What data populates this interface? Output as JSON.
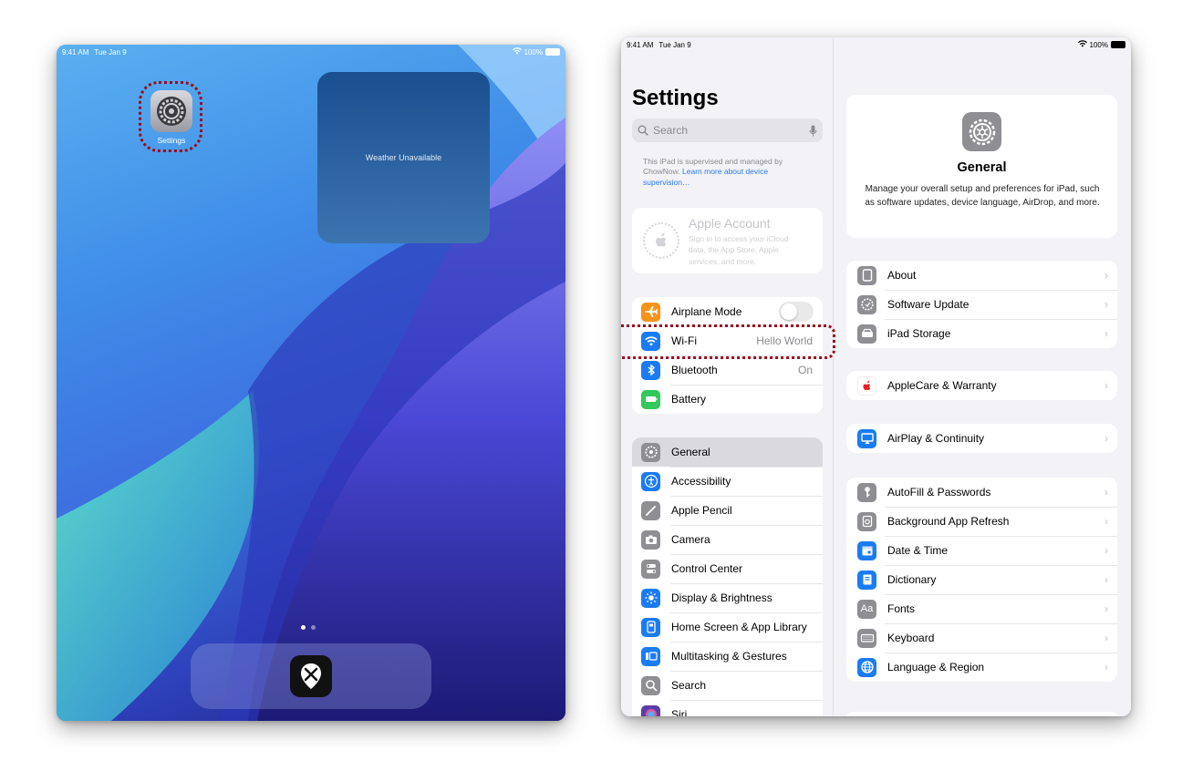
{
  "home": {
    "status": {
      "time": "9:41 AM",
      "date": "Tue Jan 9",
      "battery": "100%"
    },
    "app_label": "Settings",
    "weather_text": "Weather Unavailable"
  },
  "settings": {
    "status": {
      "time": "9:41 AM",
      "date": "Tue Jan 9",
      "battery": "100%"
    },
    "title": "Settings",
    "search_placeholder": "Search",
    "supervised_text": "This iPad is supervised and managed by ChowNow.",
    "supervised_link": "Learn more about device supervision…",
    "account": {
      "title": "Apple Account",
      "subtitle": "Sign in to access your iCloud data, the App Store, Apple services, and more."
    },
    "connectivity": [
      {
        "label": "Airplane Mode",
        "icon": "airplane-icon",
        "color": "#f7931a",
        "toggle": true
      },
      {
        "label": "Wi-Fi",
        "icon": "wifi-icon",
        "color": "#1a7cf5",
        "value": "Hello World"
      },
      {
        "label": "Bluetooth",
        "icon": "bluetooth-icon",
        "color": "#1a7cf5",
        "value": "On"
      },
      {
        "label": "Battery",
        "icon": "battery-icon",
        "color": "#34c759"
      }
    ],
    "system": [
      {
        "label": "General",
        "icon": "gear-icon",
        "color": "#8e8e93",
        "selected": true
      },
      {
        "label": "Accessibility",
        "icon": "accessibility-icon",
        "color": "#1a7cf5"
      },
      {
        "label": "Apple Pencil",
        "icon": "pencil-icon",
        "color": "#8e8e93"
      },
      {
        "label": "Camera",
        "icon": "camera-icon",
        "color": "#8e8e93"
      },
      {
        "label": "Control Center",
        "icon": "control-center-icon",
        "color": "#8e8e93"
      },
      {
        "label": "Display & Brightness",
        "icon": "sun-icon",
        "color": "#1a7cf5"
      },
      {
        "label": "Home Screen & App Library",
        "icon": "home-screen-icon",
        "color": "#1a7cf5"
      },
      {
        "label": "Multitasking & Gestures",
        "icon": "multitasking-icon",
        "color": "#1a7cf5"
      },
      {
        "label": "Search",
        "icon": "search-icon",
        "color": "#8e8e93"
      },
      {
        "label": "Siri",
        "icon": "siri-icon",
        "color": "#5a3ea8"
      }
    ]
  },
  "general": {
    "title": "General",
    "description": "Manage your overall setup and preferences for iPad, such as software updates, device language, AirDrop, and more.",
    "groups": [
      [
        {
          "label": "About",
          "icon": "ipad-icon",
          "color": "#8e8e93"
        },
        {
          "label": "Software Update",
          "icon": "gear-update-icon",
          "color": "#8e8e93"
        },
        {
          "label": "iPad Storage",
          "icon": "storage-icon",
          "color": "#8e8e93"
        }
      ],
      [
        {
          "label": "AppleCare & Warranty",
          "icon": "apple-icon",
          "color": "#e8202a"
        }
      ],
      [
        {
          "label": "AirPlay & Continuity",
          "icon": "airplay-icon",
          "color": "#1a7cf5"
        }
      ],
      [
        {
          "label": "AutoFill & Passwords",
          "icon": "key-icon",
          "color": "#8e8e93"
        },
        {
          "label": "Background App Refresh",
          "icon": "refresh-icon",
          "color": "#8e8e93"
        },
        {
          "label": "Date & Time",
          "icon": "calendar-icon",
          "color": "#1a7cf5"
        },
        {
          "label": "Dictionary",
          "icon": "book-icon",
          "color": "#1a7cf5"
        },
        {
          "label": "Fonts",
          "icon": "fonts-icon",
          "color": "#8e8e93",
          "glyph": "Aa"
        },
        {
          "label": "Keyboard",
          "icon": "keyboard-icon",
          "color": "#8e8e93"
        },
        {
          "label": "Language & Region",
          "icon": "globe-icon",
          "color": "#1a7cf5"
        }
      ]
    ]
  },
  "colors": {
    "highlight": "#9b0c1c",
    "link": "#2a7bf2"
  }
}
